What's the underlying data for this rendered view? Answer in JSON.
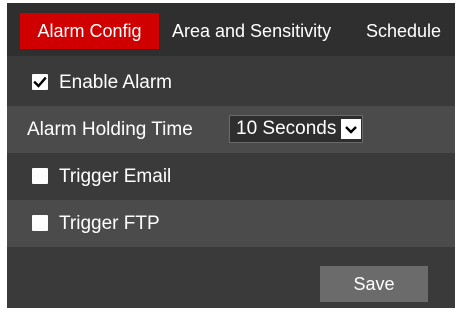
{
  "tabs": [
    {
      "label": "Alarm Config",
      "active": true
    },
    {
      "label": "Area and Sensitivity",
      "active": false
    },
    {
      "label": "Schedule",
      "active": false
    }
  ],
  "enable_alarm": {
    "label": "Enable Alarm",
    "checked": true
  },
  "holding_time": {
    "label": "Alarm Holding Time",
    "value": "10 Seconds"
  },
  "trigger_email": {
    "label": "Trigger Email",
    "checked": false
  },
  "trigger_ftp": {
    "label": "Trigger FTP",
    "checked": false
  },
  "save_label": "Save",
  "colors": {
    "active_tab": "#d00000",
    "panel_bg": "#3a3a3a",
    "row_alt_bg": "#4b4b4b",
    "button_bg": "#6b6b6b"
  },
  "icons": {
    "checkbox_checked": "check-icon",
    "select_arrow": "chevron-down-icon"
  }
}
